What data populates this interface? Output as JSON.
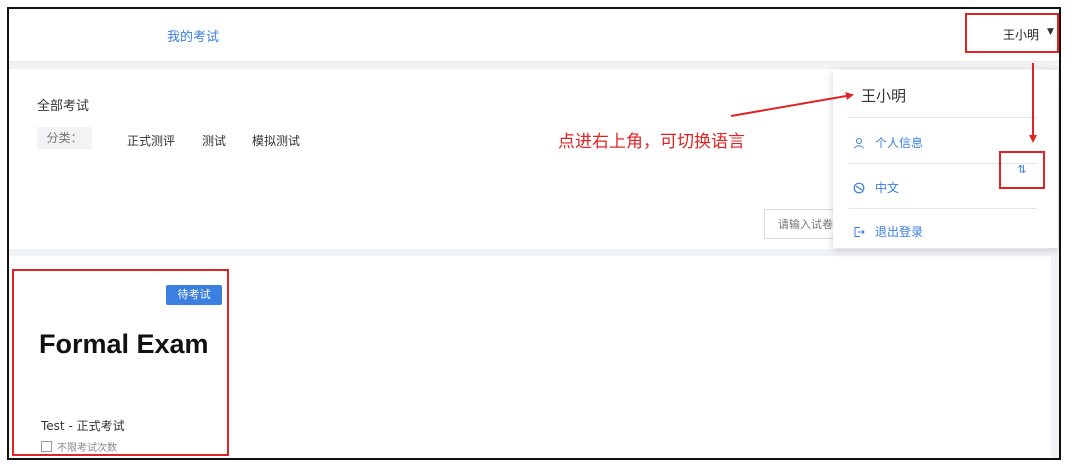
{
  "header": {
    "nav_title": "我的考试",
    "user_name": "王小明",
    "caret": "▼"
  },
  "filters": {
    "section_title": "全部考试",
    "category_label": "分类：",
    "categories": [
      "正式测评",
      "测试",
      "模拟测试"
    ],
    "search_placeholder": "请输入试卷"
  },
  "exam_card": {
    "status_badge": "待考试",
    "title": "Formal Exam",
    "name": "Test - 正式考试",
    "attempts": "不限考试次数"
  },
  "user_menu": {
    "user_name": "王小明",
    "items": [
      {
        "label": "个人信息",
        "icon": "person-icon"
      },
      {
        "label": "中文",
        "icon": "globe-icon"
      },
      {
        "label": "退出登录",
        "icon": "logout-icon"
      }
    ],
    "switch_glyph": "⇅"
  },
  "annotation": {
    "text": "点进右上角，可切换语言"
  },
  "colors": {
    "accent": "#3b7fe0",
    "highlight": "#e02424"
  }
}
